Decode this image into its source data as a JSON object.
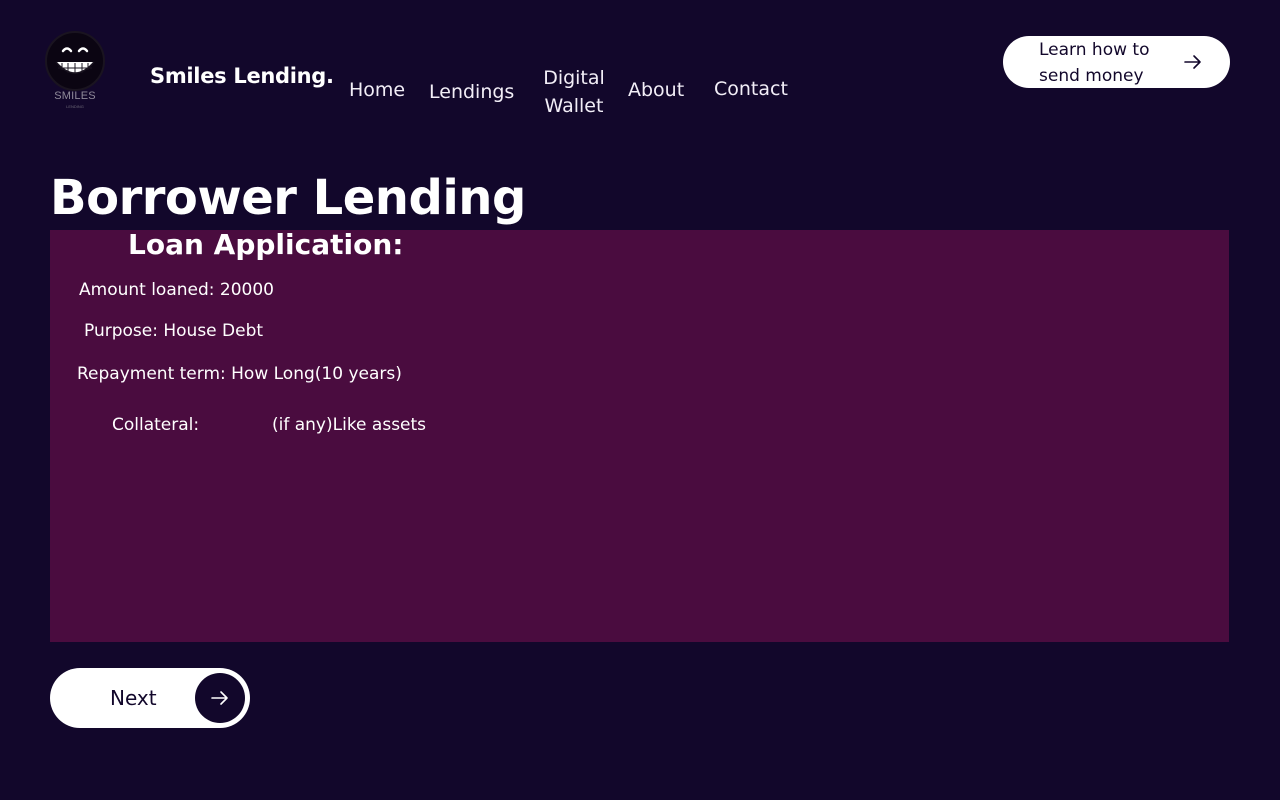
{
  "header": {
    "logo_text": "SMILES",
    "logo_subtext": "LENDING",
    "brand": "Smiles Lending.",
    "nav": {
      "home": "Home",
      "lendings": "Lendings",
      "wallet_line1": "Digital",
      "wallet_line2": "Wallet",
      "about": "About",
      "contact": "Contact"
    },
    "cta": {
      "line1": "Learn how to",
      "line2": "send money",
      "icon": "arrow-right-icon"
    }
  },
  "main": {
    "title": "Borrower Lending",
    "application": {
      "title": "Loan Application:",
      "amount": "Amount loaned: 20000",
      "purpose": "Purpose: House Debt",
      "term": "Repayment term: How Long(10 years)",
      "collateral_label": "Collateral:",
      "collateral_value": "(if any)Like assets"
    },
    "next_button": {
      "label": "Next",
      "icon": "arrow-right-icon"
    }
  },
  "colors": {
    "background": "#12072b",
    "panel": "#4a0c3f",
    "button": "#ffffff",
    "text": "#ffffff"
  }
}
